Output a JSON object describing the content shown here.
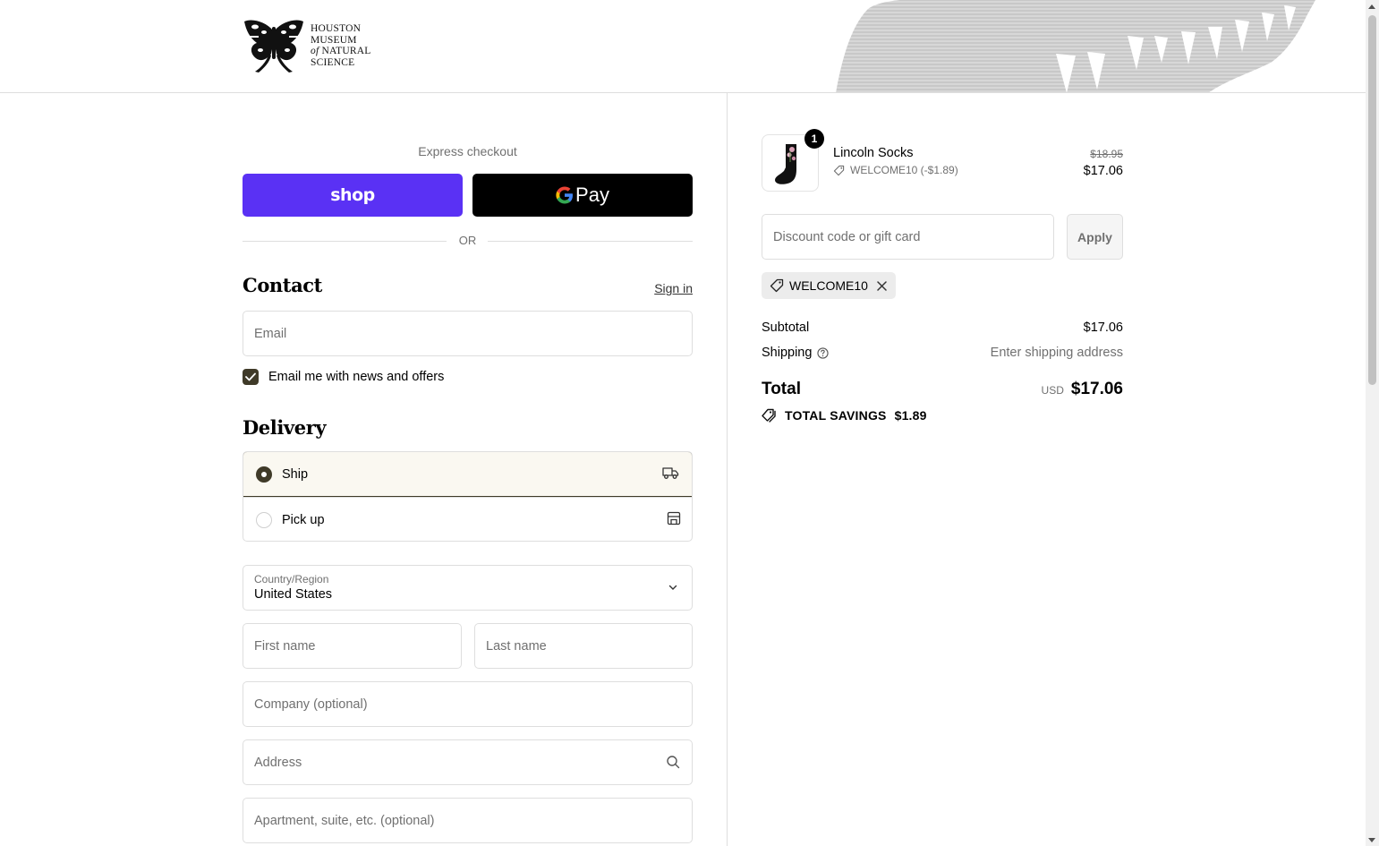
{
  "header": {
    "logo_lines": [
      "HOUSTON",
      "MUSEUM",
      "of",
      "NATURAL",
      "SCIENCE"
    ]
  },
  "express": {
    "label": "Express checkout",
    "shop_label": "shop",
    "gpay_label": "Pay",
    "or_label": "OR"
  },
  "contact": {
    "title": "Contact",
    "signin_label": "Sign in",
    "email_placeholder": "Email",
    "newsletter_label": "Email me with news and offers",
    "newsletter_checked": true
  },
  "delivery": {
    "title": "Delivery",
    "options": [
      {
        "label": "Ship",
        "selected": true,
        "icon": "truck-icon"
      },
      {
        "label": "Pick up",
        "selected": false,
        "icon": "store-icon"
      }
    ],
    "country_label": "Country/Region",
    "country_value": "United States",
    "first_name_placeholder": "First name",
    "last_name_placeholder": "Last name",
    "company_placeholder": "Company (optional)",
    "address_placeholder": "Address",
    "apartment_placeholder": "Apartment, suite, etc. (optional)"
  },
  "summary": {
    "item": {
      "name": "Lincoln Socks",
      "quantity": "1",
      "discount": "WELCOME10 (-$1.89)",
      "original_price": "$18.95",
      "price": "$17.06"
    },
    "discount_placeholder": "Discount code or gift card",
    "apply_label": "Apply",
    "applied_code": "WELCOME10",
    "subtotal_label": "Subtotal",
    "subtotal_value": "$17.06",
    "shipping_label": "Shipping",
    "shipping_value": "Enter shipping address",
    "total_label": "Total",
    "currency": "USD",
    "total_value": "$17.06",
    "savings_label": "TOTAL SAVINGS",
    "savings_value": "$1.89"
  },
  "colors": {
    "shop_purple": "#5a31f4",
    "accent_dark": "#3f3a28",
    "selected_bg": "#faf8f1"
  }
}
